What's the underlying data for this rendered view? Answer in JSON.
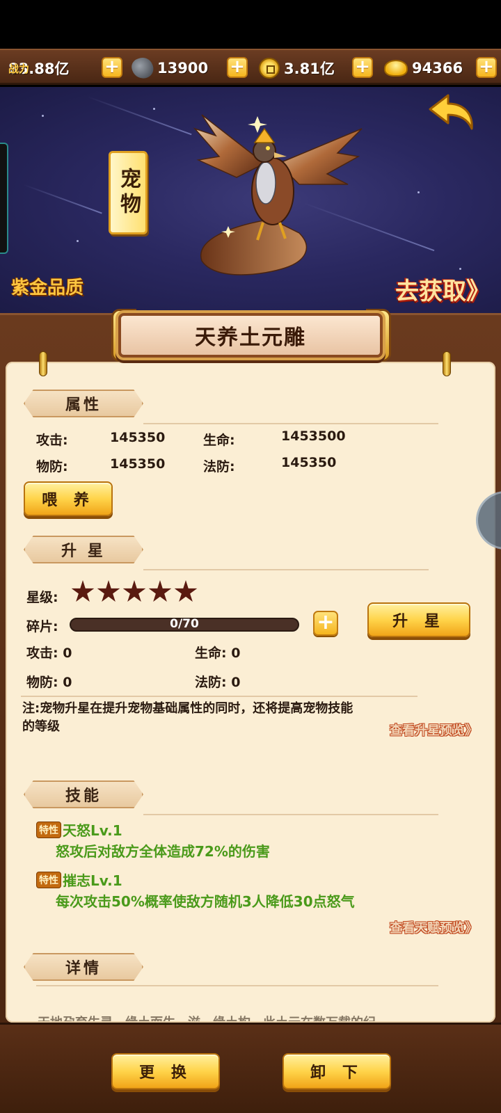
{
  "resources": {
    "power_label": "战力",
    "power_value": "83.88亿",
    "ore_value": "13900",
    "coin_value": "3.81亿",
    "ingot_value": "94366",
    "plus": "+"
  },
  "banner": {
    "pet_tag": "宠物",
    "quality": "紫金品质",
    "obtain_link": "去获取》",
    "pet_icon": "phoenix-pet-icon",
    "back_icon": "back-arrow-icon"
  },
  "pet_name": "天养土元雕",
  "attributes": {
    "section_title": "属性",
    "attack_label": "攻击:",
    "attack_value": "145350",
    "hp_label": "生命:",
    "hp_value": "1453500",
    "pdef_label": "物防:",
    "pdef_value": "145350",
    "mdef_label": "法防:",
    "mdef_value": "145350",
    "feed_button": "喂 养"
  },
  "star_up": {
    "section_title": "升 星",
    "star_label": "星级:",
    "stars": 5,
    "shard_label": "碎片:",
    "shard_text": "0/70",
    "shard_progress": 0,
    "star_up_button": "升 星",
    "attack_line": "攻击: 0",
    "hp_line": "生命: 0",
    "pdef_line": "物防: 0",
    "mdef_line": "法防: 0",
    "note": "注:宠物升星在提升宠物基础属性的同时，还将提高宠物技能的等级",
    "preview_link": "查看升星预览》"
  },
  "skills": {
    "section_title": "技能",
    "trait_badge": "特性",
    "items": [
      {
        "name": "天怒Lv.1",
        "desc": "怒攻后对敌方全体造成72%的伤害"
      },
      {
        "name": "摧志Lv.1",
        "desc": "每次攻击50%概率使敌方随机3人降低30点怒气"
      }
    ],
    "talent_link": "查看天赋预览》"
  },
  "details": {
    "section_title": "详情",
    "partial_text": "天地孕育生灵，缘土而生，滋，缘土构，此土元在数万载的纪"
  },
  "bottom": {
    "replace_button": "更 换",
    "unequip_button": "卸 下"
  },
  "colors": {
    "accent_gold": "#ffd44a",
    "skill_green": "#4a9a1a",
    "wood_brown": "#5a2f17",
    "parchment": "#fbeed4"
  }
}
